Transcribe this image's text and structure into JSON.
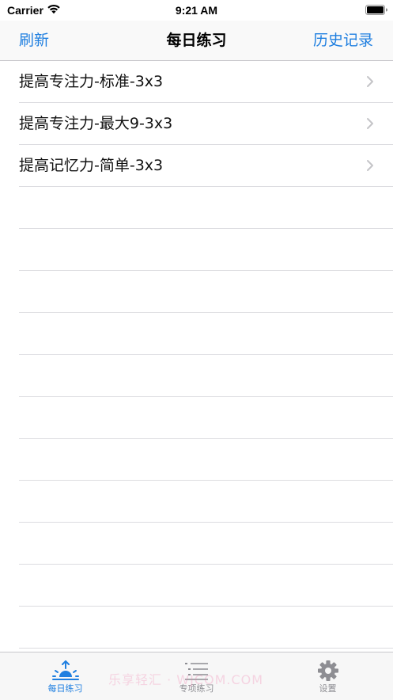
{
  "status_bar": {
    "carrier": "Carrier",
    "time": "9:21 AM",
    "wifi_icon": "wifi-icon",
    "battery_icon": "battery-icon"
  },
  "nav": {
    "left_button": "刷新",
    "title": "每日练习",
    "right_button": "历史记录"
  },
  "list": {
    "items": [
      {
        "label": "提高专注力-标准-3x3",
        "icon": "chevron-right-icon"
      },
      {
        "label": "提高专注力-最大9-3x3",
        "icon": "chevron-right-icon"
      },
      {
        "label": "提高记忆力-简单-3x3",
        "icon": "chevron-right-icon"
      }
    ]
  },
  "tab_bar": {
    "tabs": [
      {
        "label": "每日练习",
        "icon": "sunrise-icon",
        "active": true
      },
      {
        "label": "专项练习",
        "icon": "list-icon",
        "active": false
      },
      {
        "label": "设置",
        "icon": "gear-icon",
        "active": false
      }
    ],
    "watermark": "乐享轻汇 · WJCOM.COM"
  },
  "colors": {
    "accent": "#1f7fe0",
    "inactive": "#8e8e93",
    "separator": "#dcdce0",
    "nav_background": "#f9f9f9",
    "tab_background": "#f7f7f7"
  }
}
